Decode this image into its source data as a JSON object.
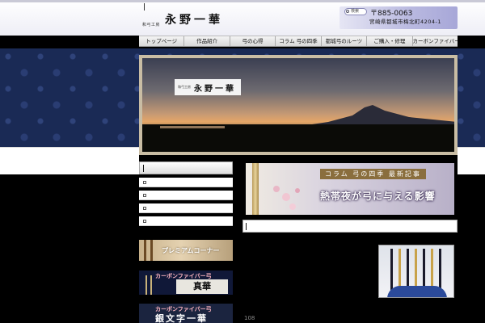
{
  "header": {
    "logo_sub": "和弓工房",
    "logo_main": "永野一華",
    "search_label": "検索",
    "postal": "〒885-0063",
    "address": "宮崎県都城市梅北町4204-1"
  },
  "nav": {
    "items": [
      "トップページ",
      "作品紹介",
      "弓の心得",
      "コラム 弓の四季",
      "都城弓のルーツ",
      "ご購入・修理",
      "カーボンファイバー弓"
    ]
  },
  "hero": {
    "logo_sub": "和弓工房",
    "logo_main": "永野一華"
  },
  "column_banner": {
    "title": "コラム 弓の四季 最新記事",
    "headline": "熱帯夜が弓に与える影響"
  },
  "banners": {
    "premium": "プレミアムコーナー",
    "shinka_sub": "カーボンファイバー弓",
    "shinka_main": "真華",
    "ginbun_sub": "カーボンファイバー弓",
    "ginbun_main": "銀文字一華"
  },
  "footer": {
    "page_num": "108"
  }
}
